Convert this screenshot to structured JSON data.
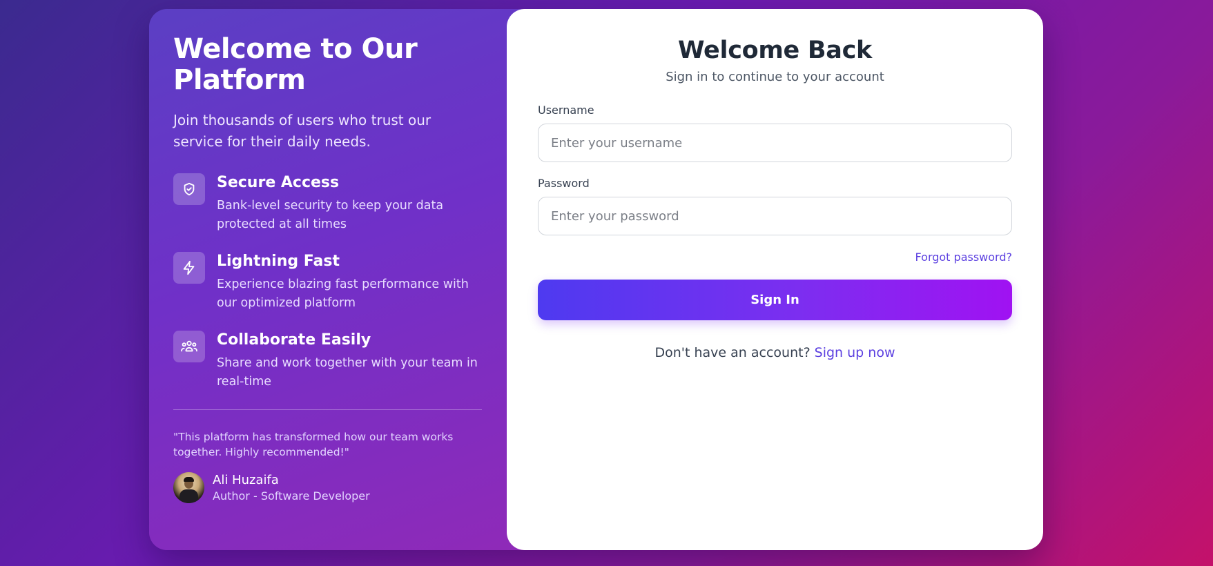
{
  "hero": {
    "title": "Welcome to Our Platform",
    "subtitle": "Join thousands of users who trust our service for their daily needs."
  },
  "features": [
    {
      "icon": "shield-check-icon",
      "title": "Secure Access",
      "description": "Bank-level security to keep your data protected at all times"
    },
    {
      "icon": "lightning-icon",
      "title": "Lightning Fast",
      "description": "Experience blazing fast performance with our optimized platform"
    },
    {
      "icon": "team-icon",
      "title": "Collaborate Easily",
      "description": "Share and work together with your team in real-time"
    }
  ],
  "testimonial": {
    "quote": "\"This platform has transformed how our team works together. Highly recommended!\"",
    "author_name": "Ali Huzaifa",
    "author_role": "Author - Software Developer"
  },
  "form": {
    "title": "Welcome Back",
    "subtitle": "Sign in to continue to your account",
    "username_label": "Username",
    "username_placeholder": "Enter your username",
    "username_value": "",
    "password_label": "Password",
    "password_placeholder": "Enter your password",
    "password_value": "",
    "forgot_label": "Forgot password?",
    "submit_label": "Sign In",
    "signup_prompt": "Don't have an account?",
    "signup_link": "Sign up now"
  },
  "colors": {
    "accent": "#5b3fe0",
    "button_start": "#4e3af0",
    "button_end": "#a012f2"
  }
}
